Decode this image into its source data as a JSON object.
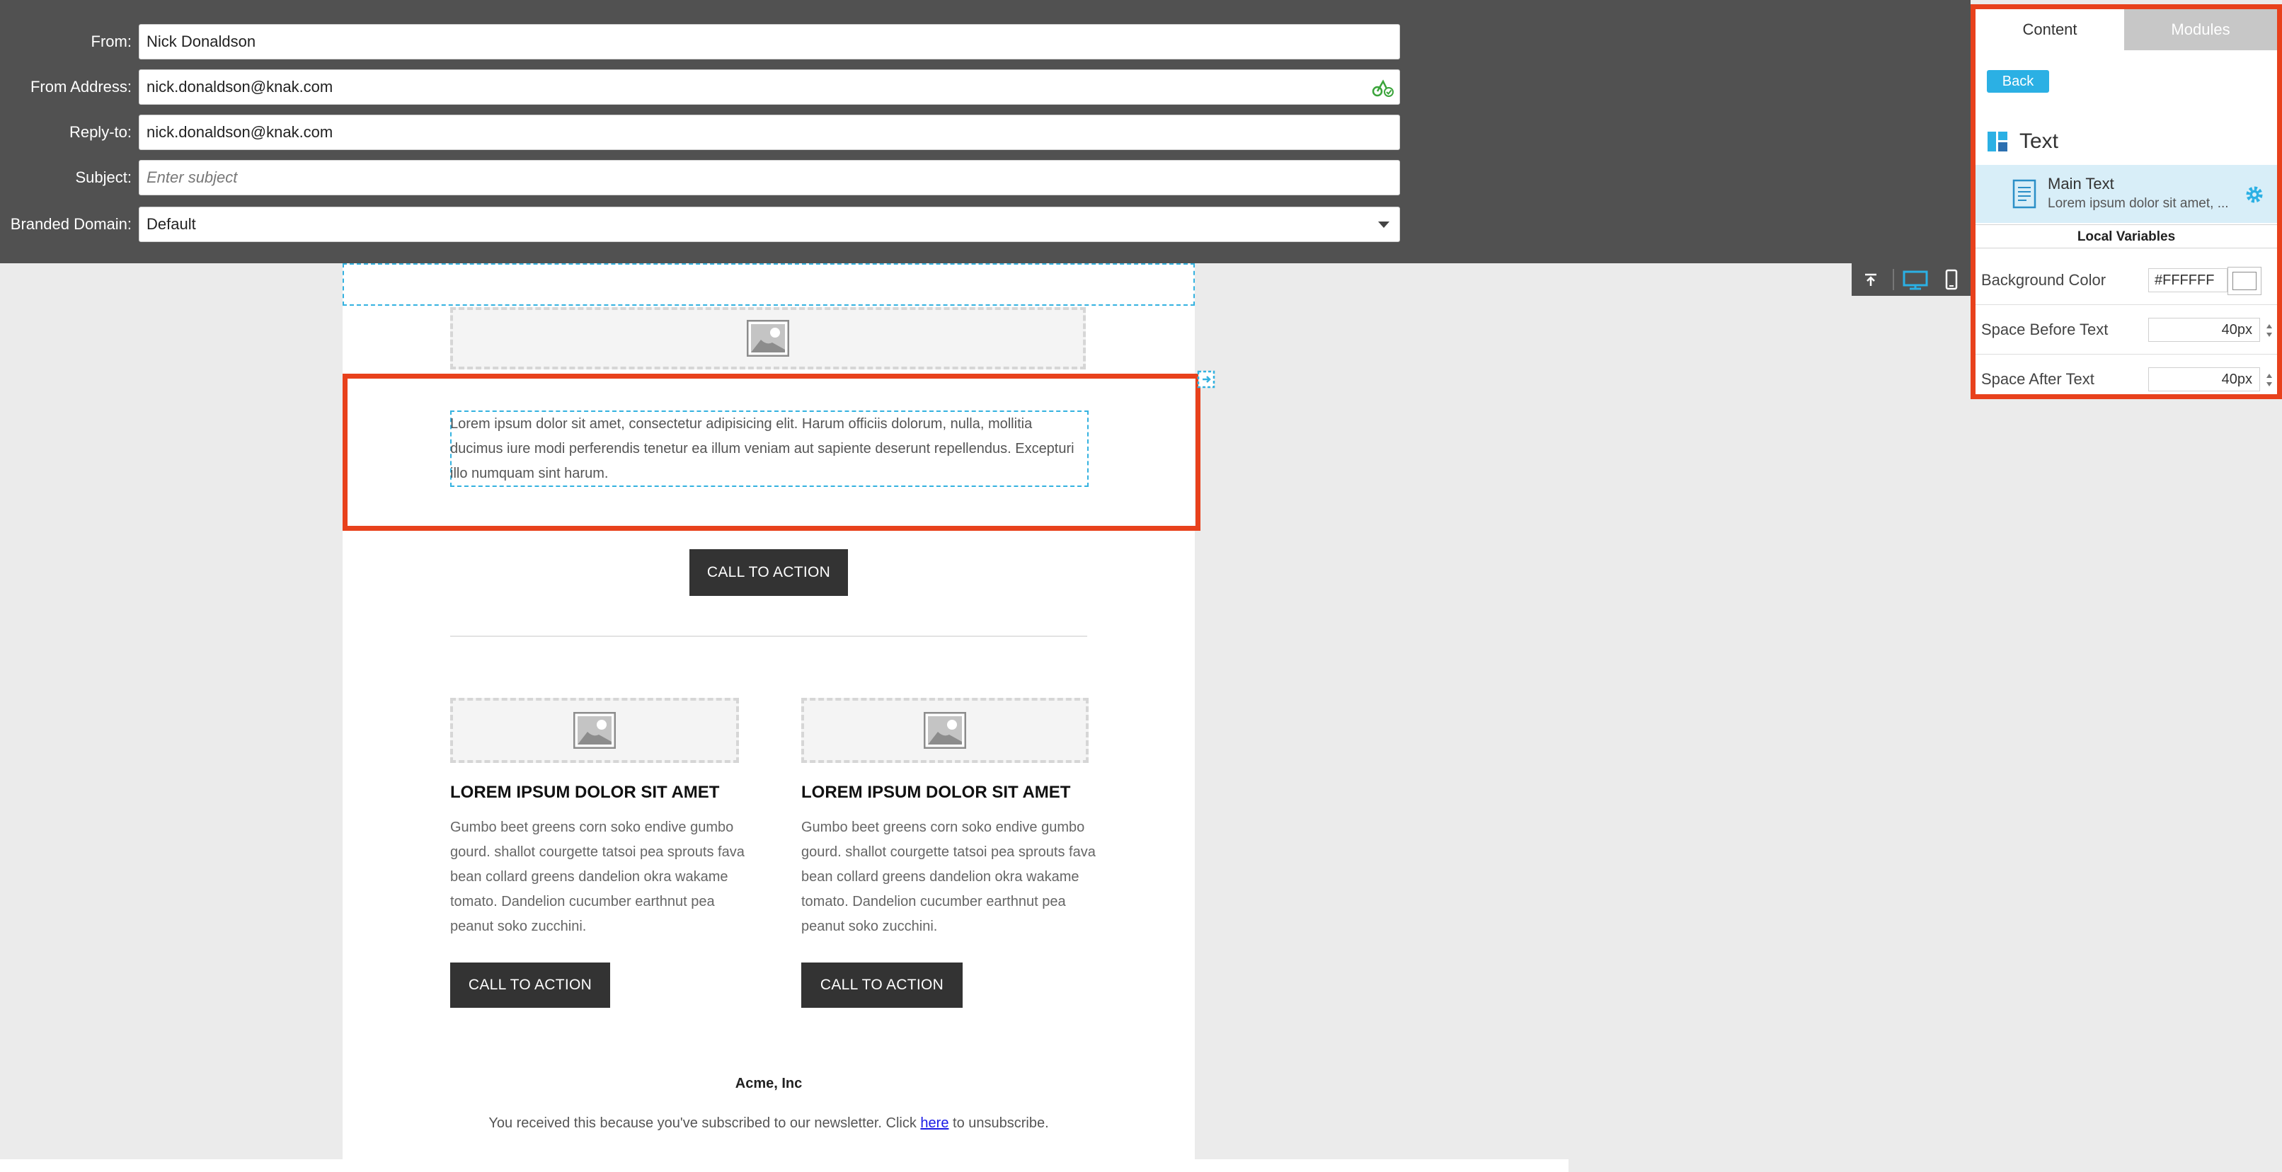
{
  "header": {
    "fields": [
      {
        "label": "From:",
        "value": "Nick Donaldson",
        "placeholder": ""
      },
      {
        "label": "From Address:",
        "value": "nick.donaldson@knak.com",
        "placeholder": ""
      },
      {
        "label": "Reply-to:",
        "value": "nick.donaldson@knak.com",
        "placeholder": ""
      },
      {
        "label": "Subject:",
        "value": "",
        "placeholder": "Enter subject"
      },
      {
        "label": "Branded Domain:",
        "value": "Default",
        "placeholder": ""
      }
    ]
  },
  "toolbar": {
    "icons": [
      "collapse-top-icon",
      "desktop-icon",
      "mobile-icon"
    ],
    "active_color": "#2bb0e4"
  },
  "email": {
    "main_text": "Lorem ipsum dolor sit amet, consectetur adipisicing elit. Harum officiis dolorum, nulla, mollitia ducimus iure modi perferendis tenetur ea illum veniam aut sapiente deserunt repellendus. Excepturi illo numquam sint harum.",
    "cta_main": "CALL TO ACTION",
    "columns": [
      {
        "title": "LOREM IPSUM DOLOR SIT AMET",
        "text": "Gumbo beet greens corn soko endive gumbo gourd. shallot courgette tatsoi pea sprouts fava bean collard greens dandelion okra wakame tomato. Dandelion cucumber earthnut pea peanut soko zucchini.",
        "cta": "CALL TO ACTION"
      },
      {
        "title": "LOREM IPSUM DOLOR SIT AMET",
        "text": "Gumbo beet greens corn soko endive gumbo gourd. shallot courgette tatsoi pea sprouts fava bean collard greens dandelion okra wakame tomato. Dandelion cucumber earthnut pea peanut soko zucchini.",
        "cta": "CALL TO ACTION"
      }
    ],
    "footer": {
      "company": "Acme, Inc",
      "text_before": "You received this because you've subscribed to our newsletter. Click ",
      "link": "here",
      "text_after": " to unsubscribe."
    }
  },
  "panel": {
    "tabs": [
      {
        "label": "Content",
        "active": true
      },
      {
        "label": "Modules",
        "active": false
      }
    ],
    "back_label": "Back",
    "section_title": "Text",
    "item": {
      "title": "Main Text",
      "subtitle": "Lorem ipsum dolor sit amet, ..."
    },
    "local_variables_label": "Local Variables",
    "properties": [
      {
        "label": "Background Color",
        "value": "#FFFFFF"
      },
      {
        "label": "Space Before Text",
        "value": "40px"
      },
      {
        "label": "Space After Text",
        "value": "40px"
      }
    ]
  },
  "colors": {
    "header_bg": "#515151",
    "accent": "#2bb0e4",
    "highlight": "#e8411c",
    "cta_bg": "#333333"
  }
}
